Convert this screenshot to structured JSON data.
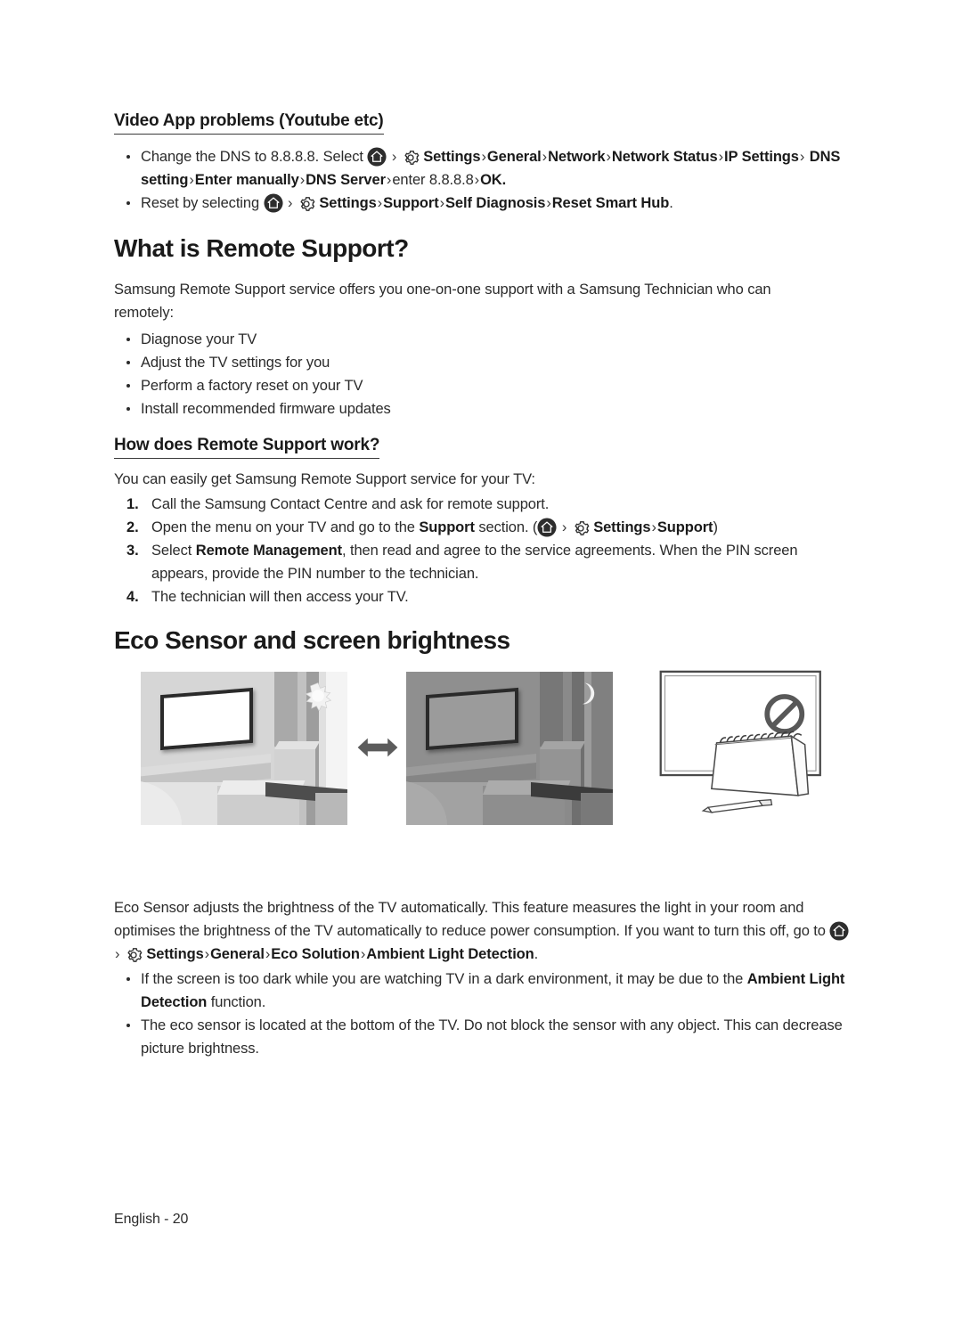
{
  "document": {
    "footer": "English - 20"
  },
  "sections": {
    "video_app": {
      "heading": "Video App problems (Youtube etc)",
      "bullets": [
        {
          "pre": "Change the DNS to 8.8.8.8. Select",
          "home_icon": "home-icon",
          "gear_icon": "gear-icon",
          "path": [
            "Settings",
            "General",
            "Network",
            "Network Status",
            "IP Settings",
            "DNS setting",
            "Enter manually",
            "DNS Server"
          ],
          "mid": "enter 8.8.8.8",
          "tail": "OK."
        },
        {
          "pre": "Reset by selecting",
          "home_icon": "home-icon",
          "gear_icon": "gear-icon",
          "path": [
            "Settings",
            "Support",
            "Self Diagnosis",
            "Reset Smart Hub"
          ],
          "tail": "."
        }
      ]
    },
    "remote_support": {
      "heading": "What is Remote Support?",
      "intro": "Samsung Remote Support service offers you one-on-one support with a Samsung Technician who can remotely:",
      "bullets": [
        "Diagnose your TV",
        "Adjust the TV settings for you",
        "Perform a factory reset on your TV",
        "Install recommended firmware updates"
      ]
    },
    "how_it_works": {
      "heading": "How does Remote Support work?",
      "intro": "You can easily get Samsung Remote Support service for your TV:",
      "steps": [
        {
          "num": "1.",
          "text": "Call the Samsung Contact Centre and ask for remote support."
        },
        {
          "num": "2.",
          "pre": "Open the menu on your TV and go to the",
          "bold": "Support",
          "post": "section. (",
          "path": [
            "Settings",
            "Support"
          ],
          "close": ")"
        },
        {
          "num": "3.",
          "pre": "Select",
          "bold": "Remote Management",
          "post": ", then read and agree to the service agreements. When the PIN screen appears, provide the PIN number to the technician."
        },
        {
          "num": "4.",
          "text": "The technician will then access your TV."
        }
      ]
    },
    "eco_sensor": {
      "heading": "Eco Sensor and screen brightness",
      "figures": {
        "light_room": "bright-living-room-with-sun",
        "dark_room": "dim-living-room-with-moon",
        "arrow": "double-arrow-icon",
        "blocked_tv": "tv-with-notepad-blocking-sensor",
        "prohibition": "no-entry-icon"
      },
      "paragraph_pre": "Eco Sensor adjusts the brightness of the TV automatically. This feature measures the light in your room and optimises the brightness of the TV automatically to reduce power consumption. If you want to turn this off, go to",
      "path": [
        "Settings",
        "General",
        "Eco Solution",
        "Ambient Light Detection"
      ],
      "paragraph_tail": ".",
      "bullets": [
        {
          "pre": "If the screen is too dark while you are watching TV in a dark environment, it may be due to the",
          "bold": "Ambient Light Detection",
          "post": "function."
        },
        {
          "pre": "The eco sensor is located at the bottom of the TV. Do not block the sensor with any object. This can decrease picture brightness.",
          "bold": "",
          "post": ""
        }
      ]
    }
  },
  "symbols": {
    "chevron": "›"
  },
  "colors": {
    "text": "#2b2b2b",
    "heading": "#1a1a1a",
    "icon_dark": "#2d2d2d",
    "scene_light_bg": "#cfcfcf",
    "scene_dark_bg": "#8d8d8d"
  }
}
